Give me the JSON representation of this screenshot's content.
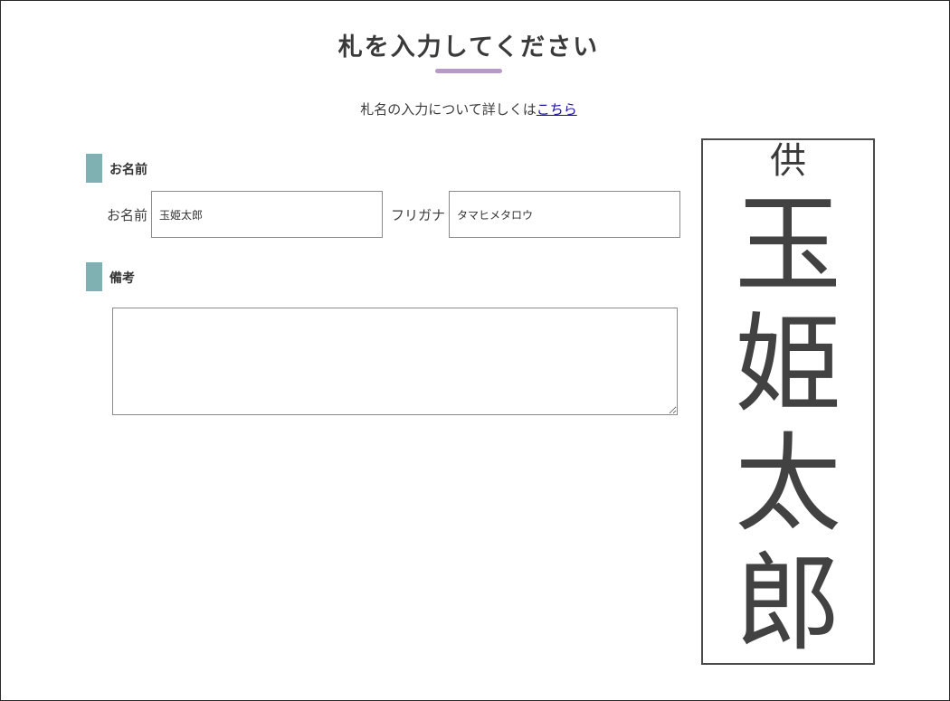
{
  "page": {
    "title": "札を入力してください",
    "intro_text": "札名の入力について詳しくは",
    "intro_link": "こちら",
    "accent_color": "#b79ac8",
    "section_bar_color": "#7fb1b2"
  },
  "name_section": {
    "heading": "お名前",
    "name_label": "お名前",
    "name_value": "玉姫太郎",
    "kana_label": "フリガナ",
    "kana_value": "タマヒメタロウ"
  },
  "notes_section": {
    "heading": "備考",
    "value": ""
  },
  "preview": {
    "offering": "供",
    "name_chars": [
      "玉",
      "姫",
      "太",
      "郎"
    ]
  }
}
